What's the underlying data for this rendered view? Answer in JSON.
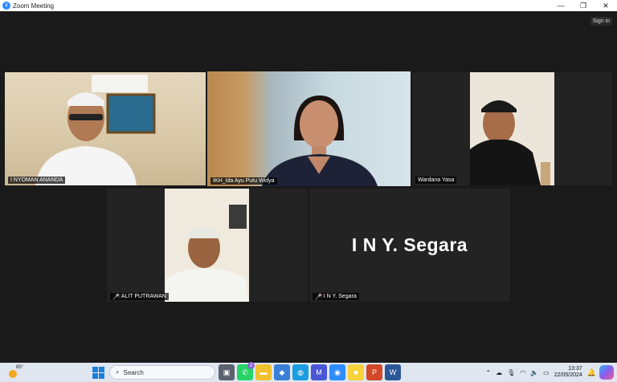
{
  "window": {
    "title": "Zoom Meeting",
    "app_icon": "zoom-icon",
    "controls": {
      "minimize": "—",
      "restore": "❐",
      "close": "✕"
    }
  },
  "meeting": {
    "sign_in_label": "Sign in",
    "participants": [
      {
        "name": "I NYOMAN ANANDA",
        "muted": false,
        "video": true
      },
      {
        "name": "IKH_Ida Ayu Putu Widya",
        "muted": false,
        "video": true,
        "active_speaker": true
      },
      {
        "name": "Wardana Yasa",
        "muted": false,
        "video": true
      },
      {
        "name": "ALIT PUTRAWAN",
        "muted": true,
        "video": true
      },
      {
        "name": "I N Y. Segara",
        "muted": true,
        "video": false,
        "placeholder_text": "I N Y. Segara"
      }
    ],
    "active_speaker_color": "#c6d94a",
    "muted_icon_color": "#e03b3b"
  },
  "taskbar": {
    "weather_temp": "85°",
    "search_placeholder": "Search",
    "apps": [
      {
        "icon": "task-view-icon",
        "glyph": "▣",
        "color": "#5a6270"
      },
      {
        "icon": "whatsapp-icon",
        "glyph": "✆",
        "color": "#25d366",
        "badge": "2"
      },
      {
        "icon": "file-explorer-icon",
        "glyph": "▬",
        "color": "#f2c12e"
      },
      {
        "icon": "microsoft-store-icon",
        "glyph": "◆",
        "color": "#3b7fd6"
      },
      {
        "icon": "edge-icon",
        "glyph": "◍",
        "color": "#1b9de2"
      },
      {
        "icon": "app-icon",
        "glyph": "M",
        "color": "#4a56d6"
      },
      {
        "icon": "zoom-icon",
        "glyph": "◉",
        "color": "#2d8cff"
      },
      {
        "icon": "sticky-notes-icon",
        "glyph": "■",
        "color": "#f7d23a"
      },
      {
        "icon": "powerpoint-icon",
        "glyph": "P",
        "color": "#d24726"
      },
      {
        "icon": "word-icon",
        "glyph": "W",
        "color": "#2b5797"
      }
    ],
    "time": "13:37",
    "date": "22/05/2024"
  }
}
